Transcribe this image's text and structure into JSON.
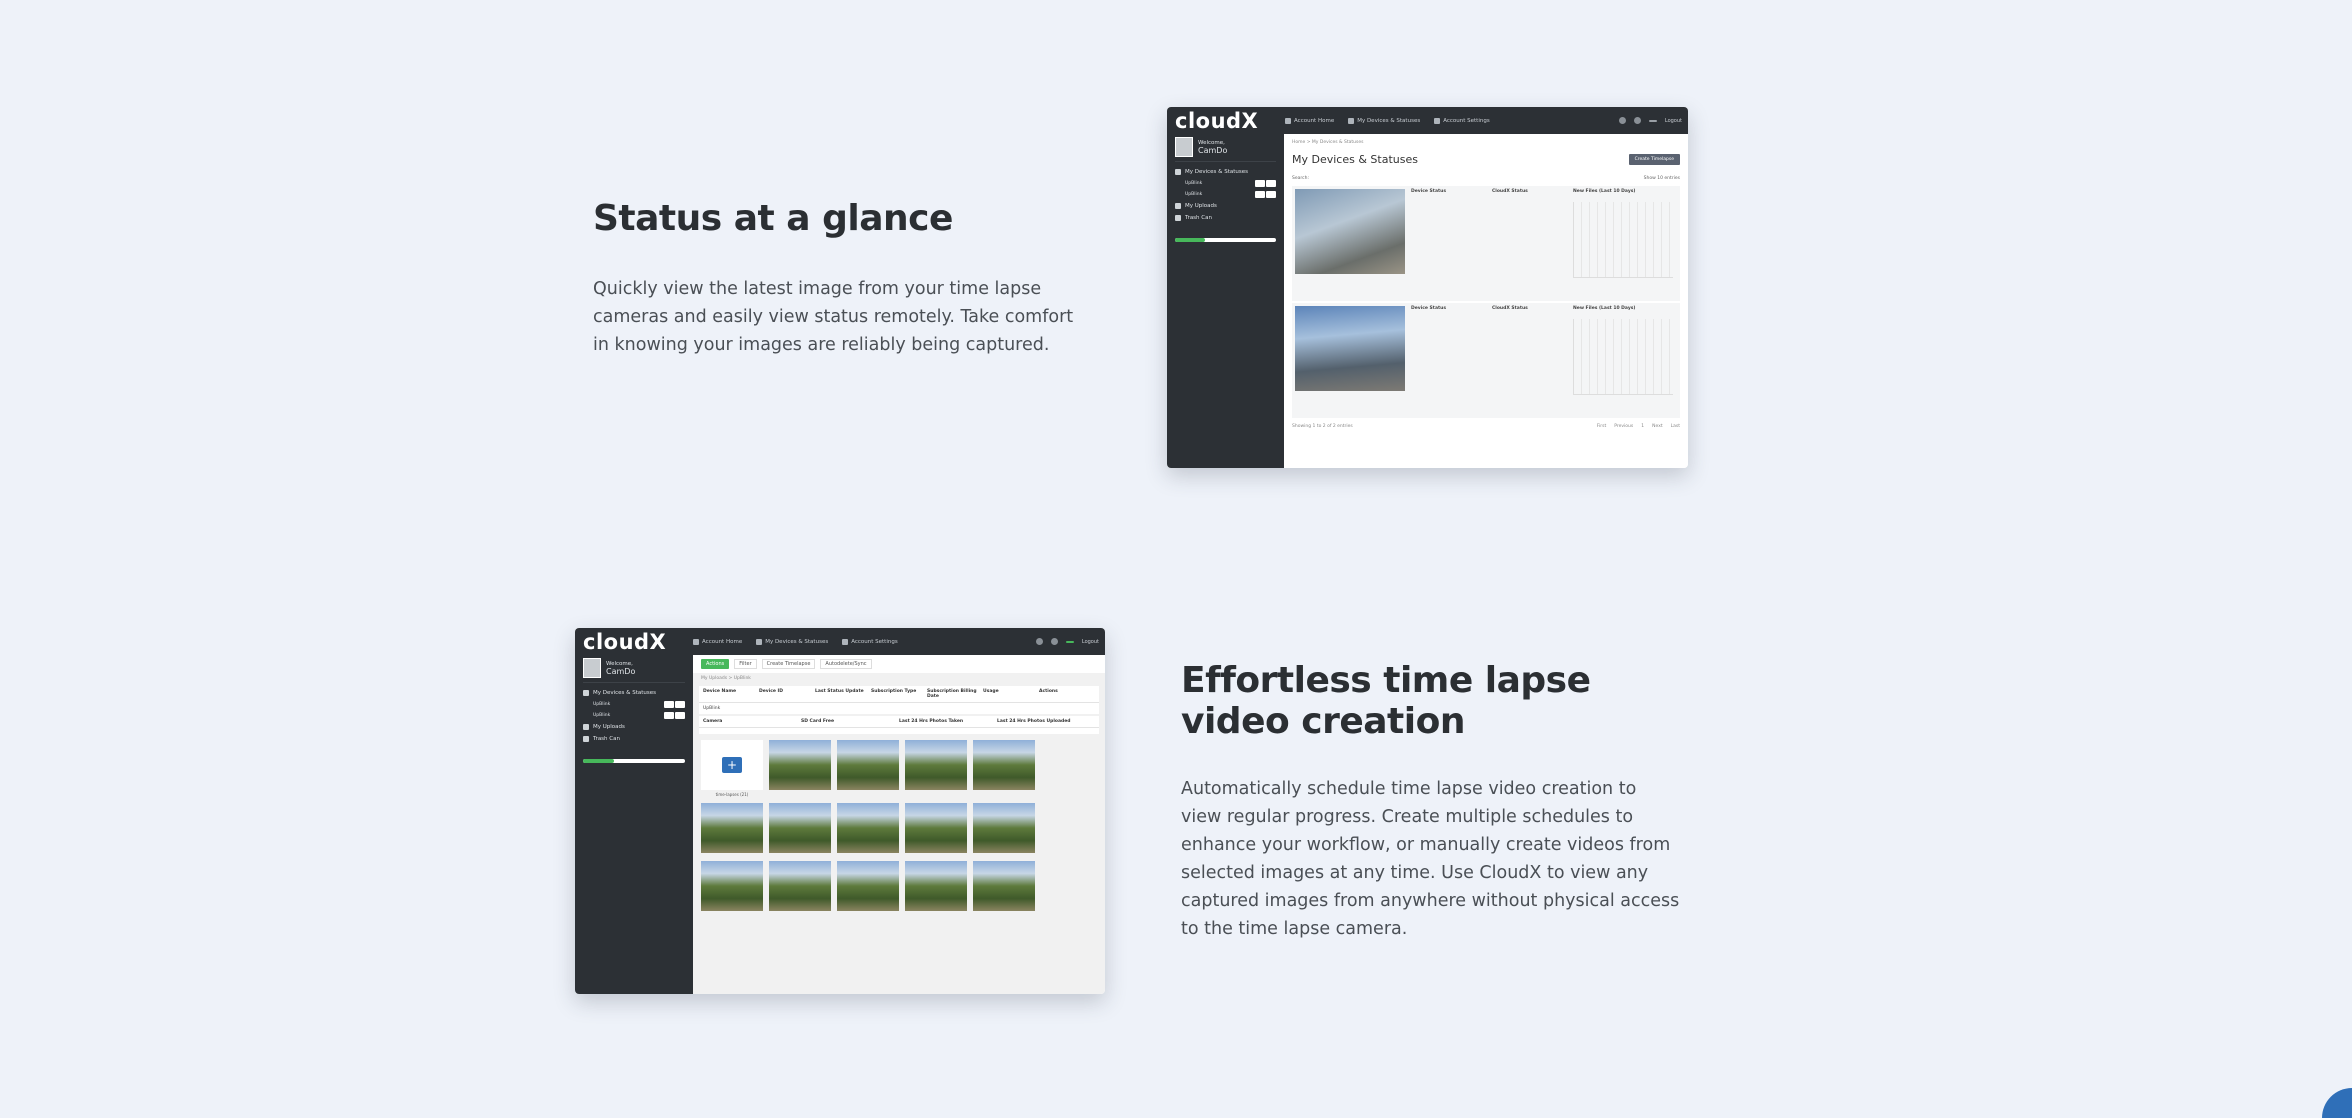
{
  "section1": {
    "title": "Status at a glance",
    "body": "Quickly view the latest image from your time lapse cameras and easily view status remotely. Take comfort in knowing your images are reliably being captured."
  },
  "section2": {
    "title": "Effortless time lapse video creation",
    "body": "Automatically schedule time lapse video creation to view regular progress. Create multiple schedules to enhance your workflow, or manually create videos from selected images at any time. Use CloudX to view any captured images from anywhere without physical access to the time lapse camera."
  },
  "app": {
    "logo": "cloudX",
    "nav": [
      "Account Home",
      "My Devices & Statuses",
      "Account Settings"
    ],
    "logout": "Logout",
    "welcome": "Welcome,",
    "user": "CamDo",
    "sidebar": [
      "My Devices & Statuses",
      "My Uploads",
      "Trash Can"
    ],
    "devices": [
      "UpBlink",
      "UpBlink"
    ]
  },
  "shot1": {
    "crumbs": "Home  >  My Devices & Statuses",
    "heading": "My Devices & Statuses",
    "create_btn": "Create Timelapse",
    "search": "Search:",
    "show": "Show 10 entries",
    "col_status": "Device Status",
    "col_cloudx": "CloudX Status",
    "col_files": "New Files (Last 10 Days)",
    "showing": "Showing 1 to 2 of 2 entries",
    "pager": [
      "First",
      "Previous",
      "1",
      "Next",
      "Last"
    ]
  },
  "shot2": {
    "actions": "Actions",
    "filter": "Filter",
    "create": "Create Timelapse",
    "autodelete": "Autodelete/Sync",
    "crumb": "My Uploads  >  UpBlink",
    "table1_headers": [
      "Device Name",
      "Device ID",
      "Last Status Update",
      "Subscription Type",
      "Subscription Billing Date",
      "Usage",
      "Actions"
    ],
    "table2_headers": [
      "Camera",
      "SD Card Free",
      "Last 24 Hrs Photos Taken",
      "Last 24 Hrs Photos Uploaded"
    ],
    "folder_label": "time-lapses (21)"
  }
}
